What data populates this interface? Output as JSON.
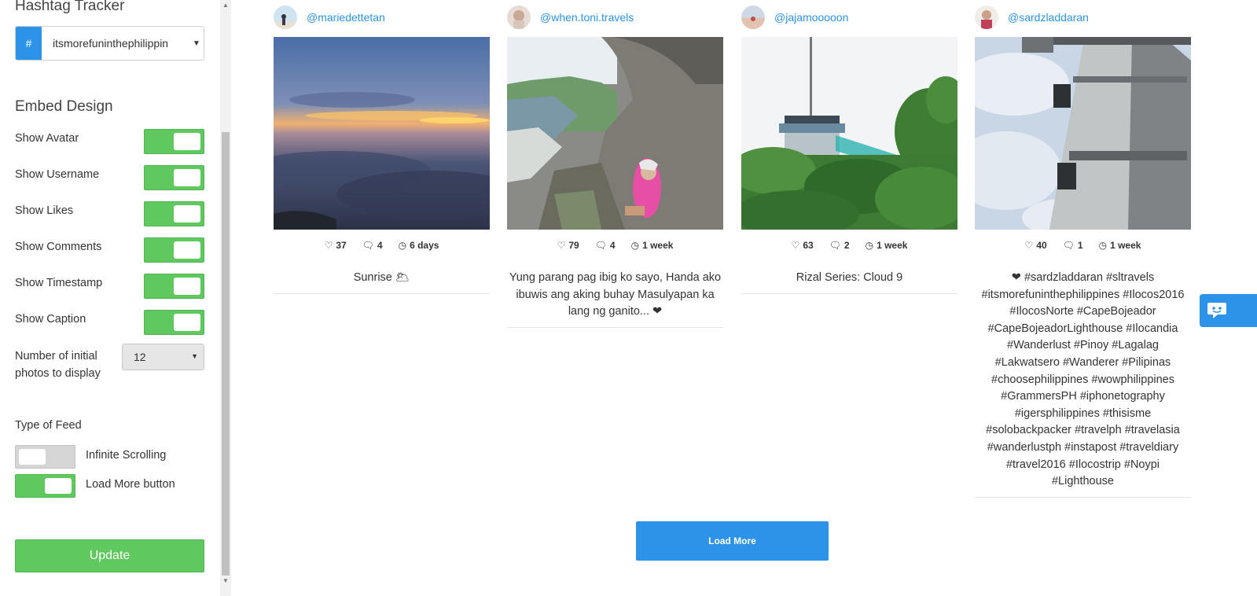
{
  "sidebar": {
    "title": "Hashtag Tracker",
    "hashtag": {
      "prefix": "#",
      "value": "itsmorefuninthephilippin"
    },
    "embed_design": {
      "title": "Embed Design",
      "toggles": [
        {
          "label": "Show Avatar",
          "on": true
        },
        {
          "label": "Show Username",
          "on": true
        },
        {
          "label": "Show Likes",
          "on": true
        },
        {
          "label": "Show Comments",
          "on": true
        },
        {
          "label": "Show Timestamp",
          "on": true
        },
        {
          "label": "Show Caption",
          "on": true
        }
      ],
      "num_photos_label": "Number of initial photos to display",
      "num_photos_value": "12"
    },
    "feed_type": {
      "title": "Type of Feed",
      "options": [
        {
          "label": "Infinite Scrolling",
          "on": false
        },
        {
          "label": "Load More button",
          "on": true
        }
      ]
    },
    "update_label": "Update"
  },
  "feed": {
    "cards": [
      {
        "username": "@mariedettetan",
        "likes": "37",
        "comments": "4",
        "time": "6 days",
        "caption": "Sunrise 🌥"
      },
      {
        "username": "@when.toni.travels",
        "likes": "79",
        "comments": "4",
        "time": "1 week",
        "caption": "Yung parang pag ibig ko sayo, Handa ako ibuwis ang aking buhay Masulyapan ka lang ng ganito... ❤"
      },
      {
        "username": "@jajamooooon",
        "likes": "63",
        "comments": "2",
        "time": "1 week",
        "caption": "Rizal Series: Cloud 9"
      },
      {
        "username": "@sardzladdaran",
        "likes": "40",
        "comments": "1",
        "time": "1 week",
        "caption": "❤ #sardzladdaran #sltravels #itsmorefuninthephilippines #Ilocos2016 #IlocosNorte #CapeBojeador #CapeBojeadorLighthouse #Ilocandia #Wanderlust #Pinoy #Lagalag #Lakwatsero #Wanderer #Pilipinas #choosephilippines #wowphilippines #GrammersPH #iphonetography #igersphilippines #thisisme #solobackpacker #travelph #travelasia #wanderlustph #instapost #traveldiary #travel2016 #Ilocostrip #Noypi #Lighthouse"
      }
    ],
    "load_more_label": "Load More"
  },
  "colors": {
    "accent_blue": "#2c93e8",
    "toggle_green": "#5fc95f"
  }
}
